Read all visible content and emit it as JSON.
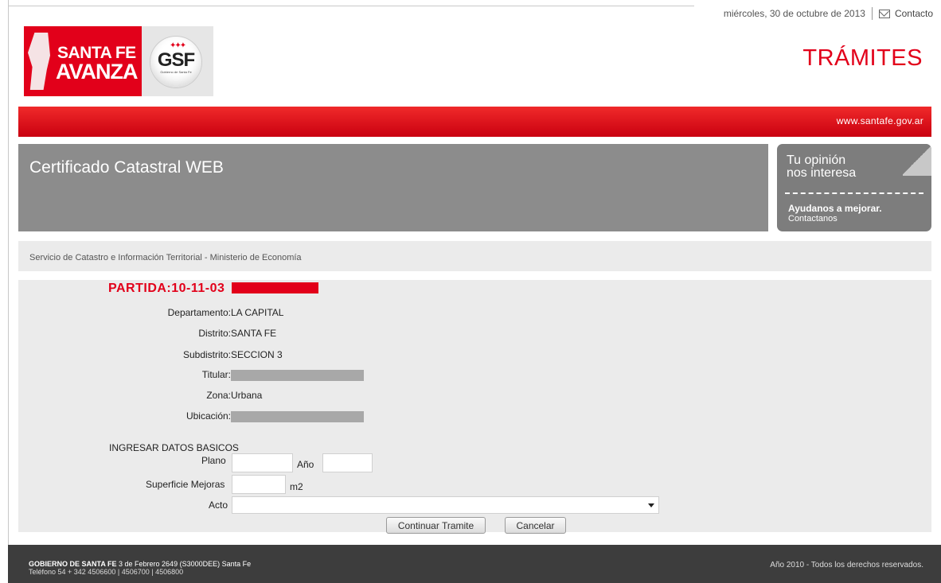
{
  "header": {
    "date": "miércoles, 30 de octubre de 2013",
    "contact_label": "Contacto",
    "logo_sf_line1": "SANTA FE",
    "logo_sf_line2": "AVANZA",
    "logo_gsf": "GSF",
    "logo_gsf_sub": "Gobierno de Santa Fe",
    "section_title": "TRÁMITES",
    "site_url": "www.santafe.gov.ar"
  },
  "page": {
    "title": "Certificado Catastral WEB",
    "service": "Servicio de Catastro e Información Territorial - Ministerio de Economía"
  },
  "opinion": {
    "line1": "Tu opinión",
    "line2": "nos interesa",
    "cta": "Ayudanos a mejorar.",
    "link": "Contactanos"
  },
  "partida": {
    "label": "PARTIDA:10-11-03",
    "fields": [
      {
        "label": "Departamento:",
        "value": "LA CAPITAL"
      },
      {
        "label": "Distrito:",
        "value": "SANTA FE"
      },
      {
        "label": "Subdistrito:",
        "value": "SECCION 3"
      },
      {
        "label": "Titular:",
        "value": ""
      },
      {
        "label": "Zona:",
        "value": "Urbana"
      },
      {
        "label": "Ubicación:",
        "value": ""
      }
    ]
  },
  "form": {
    "section_label": "INGRESAR DATOS BASICOS",
    "plano_label": "Plano",
    "plano_value": "",
    "anio_label": "Año",
    "anio_value": "",
    "superficie_label": "Superficie Mejoras",
    "superficie_value": "",
    "superficie_unit": "m2",
    "acto_label": "Acto",
    "acto_value": "",
    "continue_button": "Continuar Tramite",
    "cancel_button": "Cancelar"
  },
  "footer": {
    "org": "GOBIERNO DE SANTA FE",
    "address": " 3 de Febrero 2649 (S3000DEE) Santa Fe",
    "phones": "Teléfono 54 + 342 4506600 | 4506700 | 4506800",
    "copyright": "Año 2010 - Todos los derechos reservados."
  },
  "colors": {
    "brand_red": "#e2001a",
    "title_gray": "#8c8c8c",
    "footer": "#3d3d3d"
  }
}
